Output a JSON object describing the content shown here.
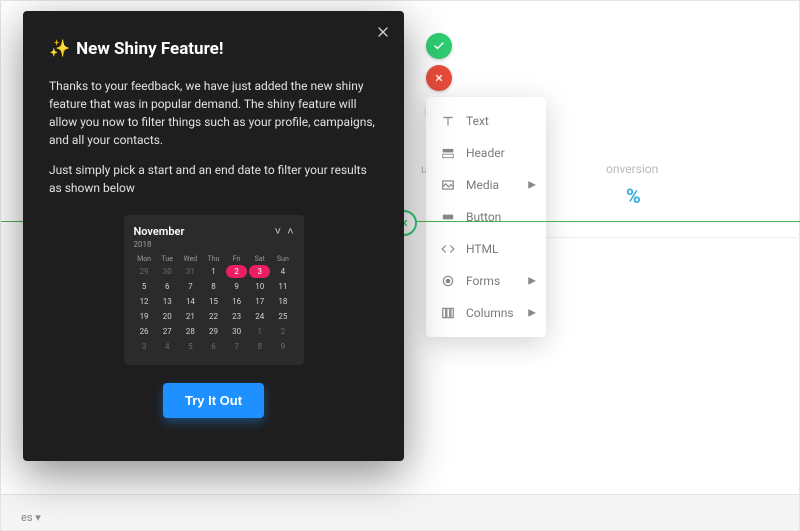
{
  "background": {
    "text_left": "ured",
    "text_right": "onversion",
    "percent": "%",
    "bottom_text": "es ▾"
  },
  "dropdown": [
    {
      "label": "Text",
      "has_submenu": false
    },
    {
      "label": "Header",
      "has_submenu": false
    },
    {
      "label": "Media",
      "has_submenu": true
    },
    {
      "label": "Button",
      "has_submenu": false
    },
    {
      "label": "HTML",
      "has_submenu": false
    },
    {
      "label": "Forms",
      "has_submenu": true
    },
    {
      "label": "Columns",
      "has_submenu": true
    }
  ],
  "modal": {
    "title": "New Shiny Feature!",
    "paragraph1": "Thanks to your feedback, we have just added the new shiny feature that was in popular demand. The shiny feature will allow you now to filter things such as your profile, campaigns, and all your contacts.",
    "paragraph2": "Just simply pick a start and an end date to filter your results as shown below",
    "cta": "Try It Out",
    "calendar": {
      "month": "November",
      "year": "2018",
      "dow": [
        "Mon",
        "Tue",
        "Wed",
        "Thu",
        "Fri",
        "Sat",
        "Sun"
      ],
      "selected": [
        2,
        3
      ],
      "days": [
        "29",
        "30",
        "31",
        "1",
        "2",
        "3",
        "4",
        "5",
        "6",
        "7",
        "8",
        "9",
        "10",
        "11",
        "12",
        "13",
        "14",
        "15",
        "16",
        "17",
        "18",
        "19",
        "20",
        "21",
        "22",
        "23",
        "24",
        "25",
        "26",
        "27",
        "28",
        "29",
        "30",
        "1",
        "2",
        "3",
        "4",
        "5",
        "6",
        "7",
        "8",
        "9"
      ]
    }
  },
  "colors": {
    "accent_blue": "#1e90ff",
    "accent_green": "#2ecc71",
    "accent_red": "#e74c3c",
    "accent_pink": "#e91e63",
    "modal_bg": "#1e1e1e"
  }
}
